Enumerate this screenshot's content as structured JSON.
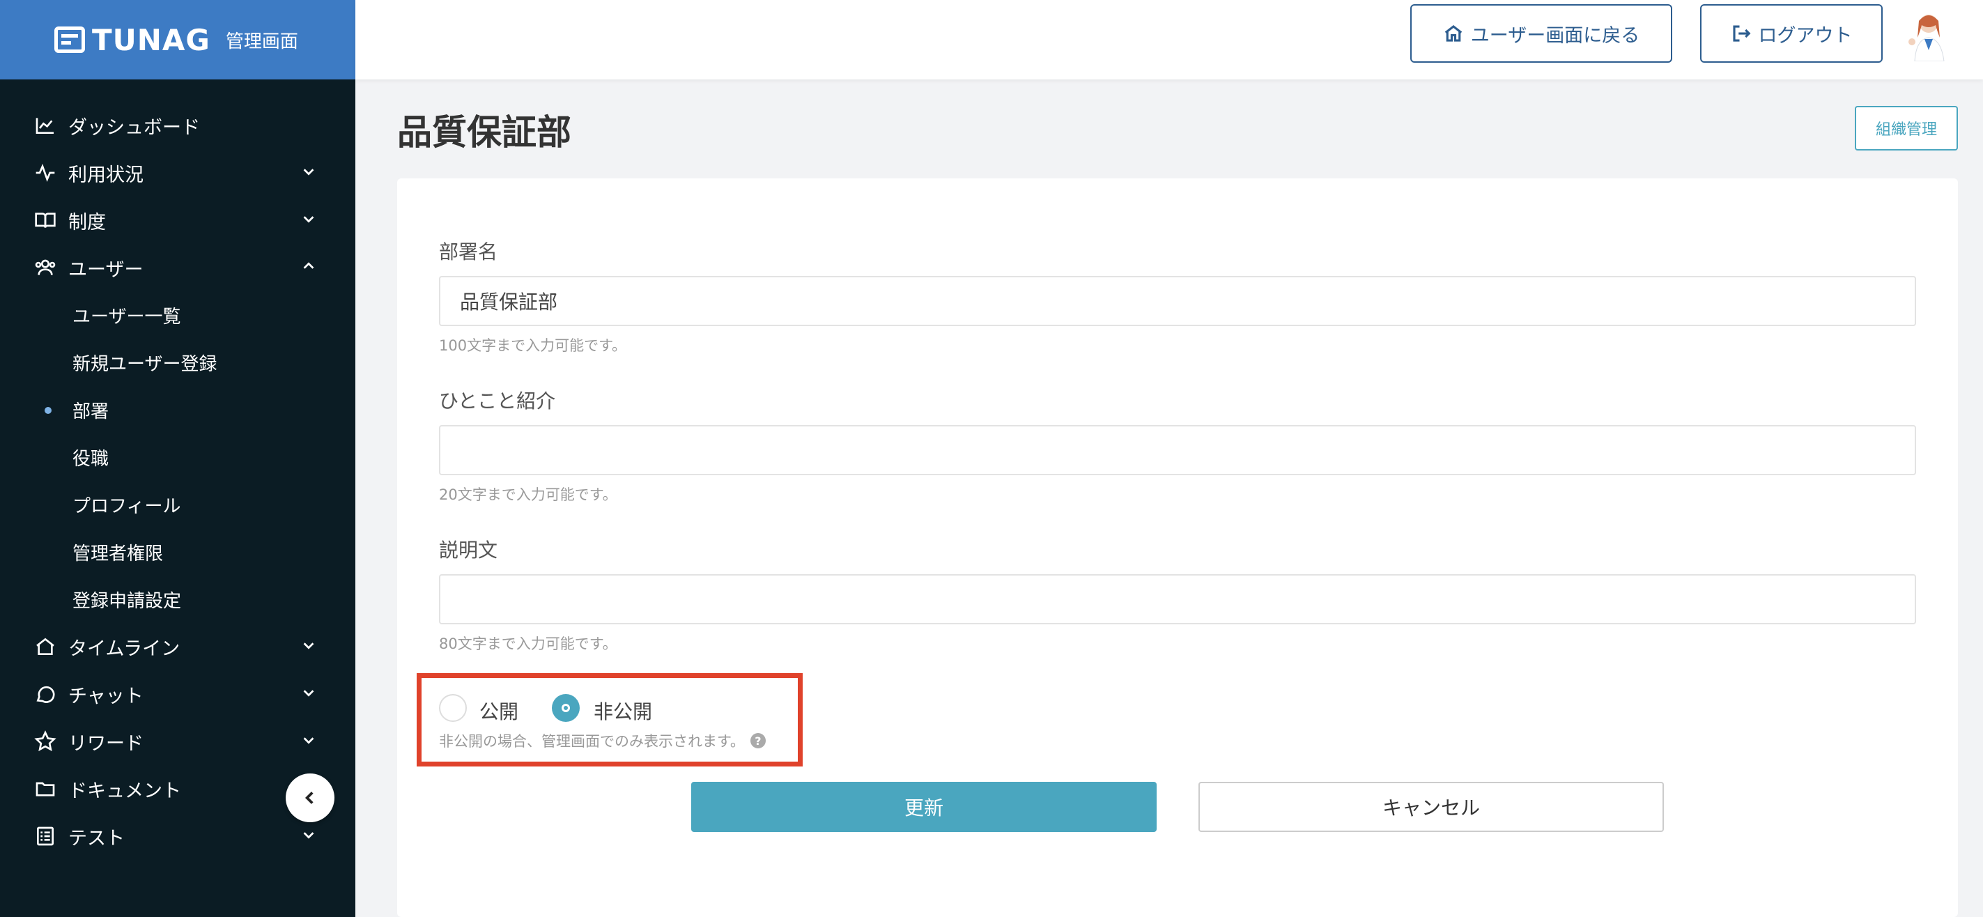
{
  "brand": {
    "name": "TUNAG",
    "subtitle": "管理画面"
  },
  "header": {
    "user_screen_button": "ユーザー画面に戻る",
    "logout_button": "ログアウト"
  },
  "sidebar": {
    "items": [
      {
        "label": "ダッシュボード",
        "icon": "chart-line-icon"
      },
      {
        "label": "利用状況",
        "icon": "activity-icon"
      },
      {
        "label": "制度",
        "icon": "book-icon"
      },
      {
        "label": "ユーザー",
        "icon": "users-icon"
      },
      {
        "label": "タイムライン",
        "icon": "home-icon"
      },
      {
        "label": "チャット",
        "icon": "chat-icon"
      },
      {
        "label": "リワード",
        "icon": "star-icon"
      },
      {
        "label": "ドキュメント",
        "icon": "folder-icon"
      },
      {
        "label": "テスト",
        "icon": "checklist-icon"
      }
    ],
    "user_subitems": [
      {
        "label": "ユーザー一覧"
      },
      {
        "label": "新規ユーザー登録"
      },
      {
        "label": "部署"
      },
      {
        "label": "役職"
      },
      {
        "label": "プロフィール"
      },
      {
        "label": "管理者権限"
      },
      {
        "label": "登録申請設定"
      }
    ],
    "active_subitem": "部署"
  },
  "page": {
    "title": "品質保証部",
    "org_button": "組織管理"
  },
  "form": {
    "department_name": {
      "label": "部署名",
      "value": "品質保証部",
      "help": "100文字まで入力可能です。"
    },
    "intro": {
      "label": "ひとこと紹介",
      "value": "",
      "help": "20文字まで入力可能です。"
    },
    "description": {
      "label": "説明文",
      "value": "",
      "help": "80文字まで入力可能です。"
    },
    "visibility": {
      "public_label": "公開",
      "private_label": "非公開",
      "selected": "非公開",
      "help": "非公開の場合、管理画面でのみ表示されます。"
    },
    "update_button": "更新",
    "cancel_button": "キャンセル"
  },
  "colors": {
    "brand_blue": "#3d7bc4",
    "sidebar_bg": "#0b1c24",
    "accent_teal": "#4aa6bf",
    "highlight_red": "#e0422b"
  }
}
